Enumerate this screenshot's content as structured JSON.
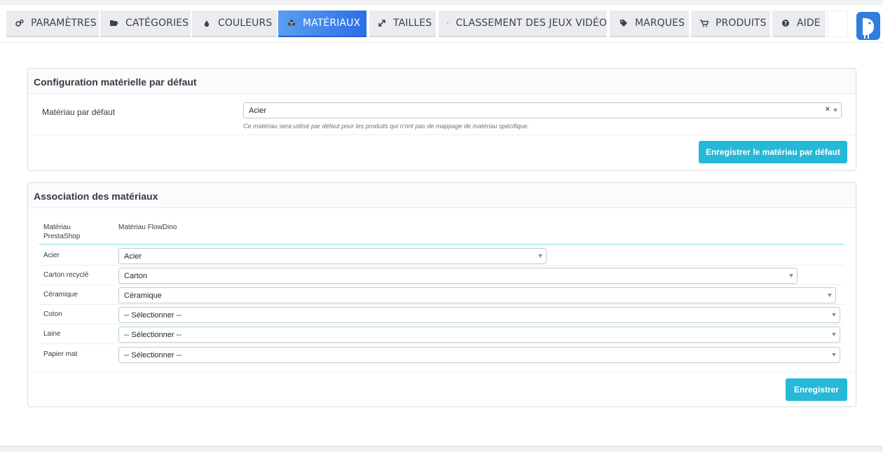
{
  "tabs": [
    {
      "label": "PARAMÈTRES",
      "icon": "cogs-icon"
    },
    {
      "label": "CATÉGORIES",
      "icon": "folder-open-icon"
    },
    {
      "label": "COULEURS",
      "icon": "tint-icon"
    },
    {
      "label": "MATÉRIAUX",
      "icon": "cube-icon",
      "active": true
    },
    {
      "label": "TAILLES",
      "icon": "expand-icon"
    },
    {
      "label": "CLASSEMENT DES JEUX VIDÉO",
      "icon": "gamepad-icon"
    },
    {
      "label": "MARQUES",
      "icon": "tag-icon"
    },
    {
      "label": "PRODUITS",
      "icon": "cart-icon"
    },
    {
      "label": "AIDE",
      "icon": "question-circle-icon"
    }
  ],
  "default_panel": {
    "title": "Configuration matérielle par défaut",
    "field_label": "Matériau par défaut",
    "selected": "Acier",
    "clear_symbol": "×",
    "help": "Ce matériau sera utilisé par défaut pour les produits qui n'ont pas de mappage de matériau spécifique.",
    "button": "Enregistrer le matériau par défaut"
  },
  "mapping_panel": {
    "title": "Association des matériaux",
    "col_prestashop_line1": "Matériau",
    "col_prestashop_line2": "PrestaShop",
    "col_flowdino": "Matériau FlowDino",
    "rows": [
      {
        "label": "Acier",
        "value": "Acier"
      },
      {
        "label": "Carton recyclé",
        "value": "Carton"
      },
      {
        "label": "Céramique",
        "value": "Céramique"
      },
      {
        "label": "Coton",
        "value": "-- Sélectionner --"
      },
      {
        "label": "Laine",
        "value": "-- Sélectionner --"
      },
      {
        "label": "Papier mat",
        "value": "-- Sélectionner --"
      }
    ],
    "button": "Enregistrer"
  },
  "colors": {
    "accent": "#25b9d7",
    "active_tab_start": "#5a9ff2",
    "active_tab_end": "#2b6fe6"
  }
}
